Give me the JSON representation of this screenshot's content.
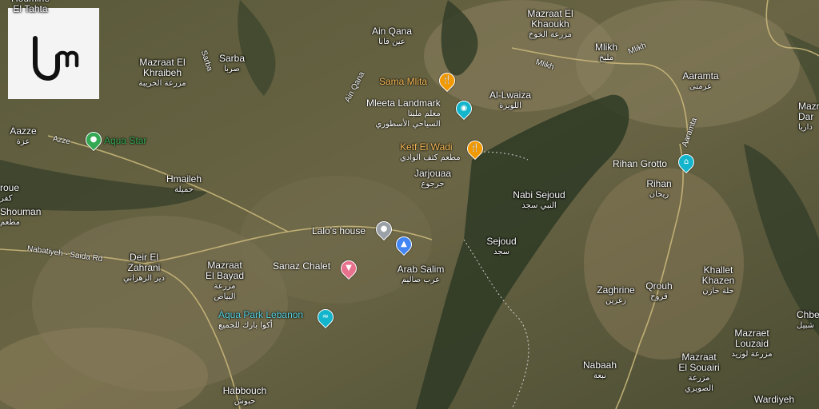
{
  "map": {
    "places": [
      {
        "id": "mazraat-el-khraibeh",
        "name": "Mazraat El\nKhraibeh",
        "arabic": "مزرعة الخريبة"
      },
      {
        "id": "sarba",
        "name": "Sarba",
        "arabic": "صربا"
      },
      {
        "id": "ain-qana",
        "name": "Ain Qana",
        "arabic": "عين قانا"
      },
      {
        "id": "mazraat-el-khaoukh",
        "name": "Mazraat El\nKhaoukh",
        "arabic": "مزرعة الخوخ"
      },
      {
        "id": "mlikh",
        "name": "Mlikh",
        "arabic": "مليخ"
      },
      {
        "id": "aaramta",
        "name": "Aaramta",
        "arabic": "عرمتى"
      },
      {
        "id": "al-lwaiza",
        "name": "Al-Lwaiza",
        "arabic": "اللويزة"
      },
      {
        "id": "aazze",
        "name": "Aazze",
        "arabic": "عزة"
      },
      {
        "id": "hmaileh",
        "name": "Hmaileh",
        "arabic": "حميلة"
      },
      {
        "id": "jarjouaa",
        "name": "Jarjouaa",
        "arabic": "جرجوع"
      },
      {
        "id": "nabi-sejoud",
        "name": "Nabi Sejoud",
        "arabic": "النبي سجد"
      },
      {
        "id": "sejoud",
        "name": "Sejoud",
        "arabic": "سجد"
      },
      {
        "id": "rihan",
        "name": "Rihan",
        "arabic": "ريحان"
      },
      {
        "id": "roue",
        "name": "roue",
        "arabic": "كفر"
      },
      {
        "id": "shouman",
        "name": "Shouman",
        "arabic": "مطعم"
      },
      {
        "id": "deir-el-zahrani",
        "name": "Deir El\nZahrani",
        "arabic": "دير الزهراني"
      },
      {
        "id": "mazraat-el-bayad",
        "name": "Mazraat\nEl Bayad",
        "arabic": "مزرعة\nالبياض"
      },
      {
        "id": "arab-salim",
        "name": "Arab Salim",
        "arabic": "عرب صاليم"
      },
      {
        "id": "khallet-khazen",
        "name": "Khallet\nKhazen",
        "arabic": "حلة خازن"
      },
      {
        "id": "qrouh",
        "name": "Qrouh",
        "arabic": "قروح"
      },
      {
        "id": "zaghrine",
        "name": "Zaghrine",
        "arabic": "زغرين"
      },
      {
        "id": "mazraet-louzaid",
        "name": "Mazraet\nLouzaid",
        "arabic": "مزرعة لوزيد"
      },
      {
        "id": "mazraat-el-souairi",
        "name": "Mazraat\nEl Souairi",
        "arabic": "مزرعة\nالصويري"
      },
      {
        "id": "nabaah",
        "name": "Nabaah",
        "arabic": "نبعة"
      },
      {
        "id": "habbouch",
        "name": "Habbouch",
        "arabic": "حبوش"
      },
      {
        "id": "wardiyeh",
        "name": "Wardiyeh",
        "arabic": ""
      },
      {
        "id": "mazraat-dar",
        "name": "Mazr\nDar",
        "arabic": "داريا"
      },
      {
        "id": "chbe",
        "name": "Chbe",
        "arabic": "شبيل"
      }
    ],
    "pois": [
      {
        "id": "aqua-star",
        "name": "Aqua Star",
        "arabic": "",
        "color": "#34a853",
        "icon": "pin-icon"
      },
      {
        "id": "sama-mlita",
        "name": "Sama Mlita",
        "arabic": "",
        "color": "#f29900",
        "icon": "restaurant-icon"
      },
      {
        "id": "mleeta-landmark",
        "name": "Mleeta Landmark",
        "arabic": "معلم مليتا\nالسياحي الأسطوري",
        "color": "#12b5cb",
        "icon": "camera-icon"
      },
      {
        "id": "ketf-el-wadi",
        "name": "Ketf El Wadi",
        "arabic": "مطعم كتف الوادي",
        "color": "#f29900",
        "icon": "restaurant-icon"
      },
      {
        "id": "rihan-grotto",
        "name": "Rihan Grotto",
        "arabic": "",
        "color": "#12b5cb",
        "icon": "landmark-icon"
      },
      {
        "id": "lalos-house",
        "name": "Lalo's house",
        "arabic": "",
        "color": "#9aa0a6",
        "icon": "pin-icon"
      },
      {
        "id": "arab-salim-hotel",
        "name": "",
        "arabic": "",
        "color": "#4285f4",
        "icon": "lodging-icon"
      },
      {
        "id": "sanaz-chalet",
        "name": "Sanaz Chalet",
        "arabic": "",
        "color": "#e8718d",
        "icon": "lodging-icon"
      },
      {
        "id": "aqua-park-lebanon",
        "name": "Aqua Park Lebanon",
        "arabic": "أكوا بارك للجميع",
        "color": "#12b5cb",
        "icon": "pool-icon"
      }
    ],
    "roads": [
      {
        "id": "sarba-road",
        "name": "Sarba"
      },
      {
        "id": "ain-qana-road",
        "name": "Ain Qana"
      },
      {
        "id": "azze-road",
        "name": "Azze"
      },
      {
        "id": "mlikh-road-1",
        "name": "Mlikh"
      },
      {
        "id": "mlikh-road-2",
        "name": "Mlikh"
      },
      {
        "id": "aaramta-road",
        "name": "Aaramta"
      },
      {
        "id": "nabatiyeh-saida-rd",
        "name": "Nabatiyeh - Saida Rd"
      }
    ],
    "partial_top_label": "Houmine\nEl Tahta"
  },
  "logo": {
    "text": "um",
    "background": "#f4f4f4",
    "color": "#111111"
  }
}
